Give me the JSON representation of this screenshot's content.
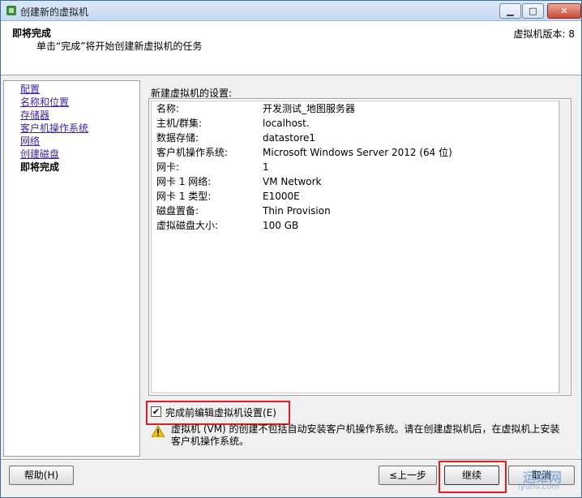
{
  "window": {
    "title": "创建新的虚拟机"
  },
  "header": {
    "title": "即将完成",
    "subtitle": "单击“完成”将开始创建新虚拟机的任务",
    "version": "虚拟机版本: 8"
  },
  "nav": {
    "items": [
      {
        "label": "配置"
      },
      {
        "label": "名称和位置"
      },
      {
        "label": "存储器"
      },
      {
        "label": "客户机操作系统"
      },
      {
        "label": "网络"
      },
      {
        "label": "创建磁盘"
      },
      {
        "label": "即将完成"
      }
    ]
  },
  "settings": {
    "label": "新建虚拟机的设置:",
    "rows": [
      {
        "key": "名称:",
        "value": "开发测试_地图服务器"
      },
      {
        "key": "主机/群集:",
        "value": "localhost."
      },
      {
        "key": "数据存储:",
        "value": "datastore1"
      },
      {
        "key": "客户机操作系统:",
        "value": "Microsoft Windows Server 2012 (64 位)"
      },
      {
        "key": "网卡:",
        "value": "1"
      },
      {
        "key": "网卡 1 网络:",
        "value": "VM Network"
      },
      {
        "key": "网卡 1 类型:",
        "value": "E1000E"
      },
      {
        "key": "磁盘置备:",
        "value": "Thin Provision"
      },
      {
        "key": "虚拟磁盘大小:",
        "value": "100 GB"
      }
    ]
  },
  "edit_checkbox": {
    "label": "完成前编辑虚拟机设置(E)",
    "checked_glyph": "✔"
  },
  "warning": {
    "text": "虚拟机 (VM) 的创建不包括自动安装客户机操作系统。请在创建虚拟机后，在虚拟机上安装客户机操作系统。"
  },
  "buttons": {
    "help": "帮助(H)",
    "back": "≤上一步",
    "continue": "继续",
    "cancel": "取消"
  },
  "watermark": {
    "line1": "运维网",
    "line2": "iyunv.com"
  },
  "colors": {
    "link": "#3f24a8",
    "highlight_box": "#e02020",
    "title_bar": "#c4d9f1"
  }
}
